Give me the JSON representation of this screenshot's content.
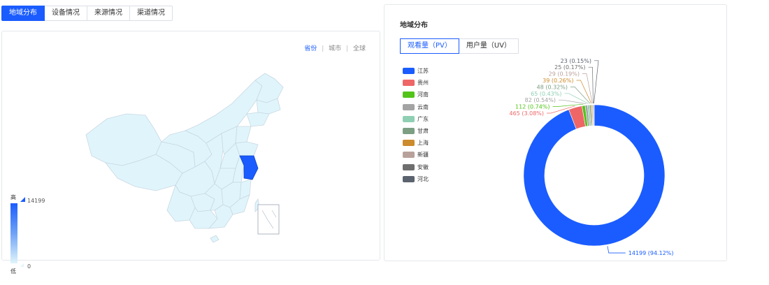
{
  "tabs": [
    {
      "label": "地域分布",
      "active": true
    },
    {
      "label": "设备情况",
      "active": false
    },
    {
      "label": "来源情况",
      "active": false
    },
    {
      "label": "渠道情况",
      "active": false
    }
  ],
  "map_panel": {
    "scope_links": [
      {
        "label": "省份",
        "active": true
      },
      {
        "label": "城市",
        "active": false
      },
      {
        "label": "全球",
        "active": false
      }
    ],
    "separator": "|",
    "legend": {
      "high": "高",
      "low": "低",
      "max": "14199",
      "min": "0"
    },
    "colors": {
      "low": "#e0f5fb",
      "high": "#1a5cff",
      "border": "#c8d7e3"
    }
  },
  "chart_panel": {
    "title": "地域分布",
    "metric_buttons": [
      {
        "label": "观看量（PV）",
        "active": true
      },
      {
        "label": "用户量（UV）",
        "active": false
      }
    ]
  },
  "chart_data": {
    "type": "pie",
    "variant": "donut",
    "legend_position": "left",
    "slices": [
      {
        "name": "江苏",
        "value": 14199,
        "percent": "94.12%",
        "color": "#1a5cff"
      },
      {
        "name": "贵州",
        "value": 465,
        "percent": "3.08%",
        "color": "#ee6666"
      },
      {
        "name": "河南",
        "value": 112,
        "percent": "0.74%",
        "color": "#52c41a"
      },
      {
        "name": "云南",
        "value": 82,
        "percent": "0.54%",
        "color": "#a3a3a3"
      },
      {
        "name": "广东",
        "value": 65,
        "percent": "0.43%",
        "color": "#8fcfb3"
      },
      {
        "name": "甘肃",
        "value": 48,
        "percent": "0.32%",
        "color": "#7c9f83"
      },
      {
        "name": "上海",
        "value": 39,
        "percent": "0.26%",
        "color": "#cc8b2c"
      },
      {
        "name": "新疆",
        "value": 29,
        "percent": "0.19%",
        "color": "#b9a19b"
      },
      {
        "name": "安徽",
        "value": 25,
        "percent": "0.17%",
        "color": "#6e6e6e"
      },
      {
        "name": "河北",
        "value": 23,
        "percent": "0.15%",
        "color": "#5b636f"
      }
    ]
  }
}
